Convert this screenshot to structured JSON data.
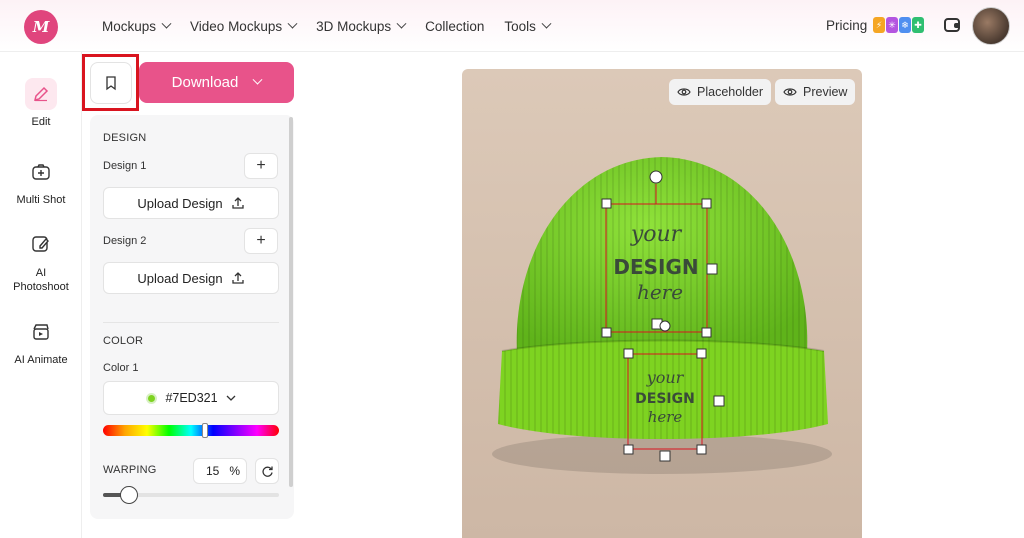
{
  "topnav": {
    "logo_text": "M",
    "items": [
      {
        "label": "Mockups",
        "dropdown": true
      },
      {
        "label": "Video Mockups",
        "dropdown": true
      },
      {
        "label": "3D Mockups",
        "dropdown": true
      },
      {
        "label": "Collection",
        "dropdown": false
      },
      {
        "label": "Tools",
        "dropdown": true
      }
    ],
    "pricing_label": "Pricing",
    "pricing_badge_icons": [
      "lightning-icon",
      "snowflake-icon",
      "snowflake-icon",
      "gamepad-icon"
    ]
  },
  "rail": {
    "items": [
      {
        "label": "Edit",
        "icon": "pencil-icon",
        "active": true
      },
      {
        "label": "Multi Shot",
        "icon": "camera-plus-icon",
        "active": false
      },
      {
        "label": "AI Photoshoot",
        "icon": "edit-image-icon",
        "active": false
      },
      {
        "label": "AI Animate",
        "icon": "clapperboard-icon",
        "active": false
      }
    ]
  },
  "toolbar": {
    "download_label": "Download"
  },
  "panel": {
    "design_section": "DESIGN",
    "design1_label": "Design 1",
    "design2_label": "Design 2",
    "upload_label": "Upload Design",
    "color_section": "COLOR",
    "color1_label": "Color 1",
    "color_value": "#7ED321",
    "hue_position": 0.58,
    "warping_label": "WARPING",
    "warping_value": "15",
    "warping_unit": "%",
    "warping_fraction": 0.15
  },
  "canvas": {
    "placeholder_label": "Placeholder",
    "preview_label": "Preview",
    "hat_color": "#7ED321",
    "design_text": {
      "line1": "your",
      "line2": "DESIGN",
      "line3": "here"
    }
  },
  "colors": {
    "brand": "#E8538A",
    "highlight": "#D9141F",
    "panel_bg": "#F6F6F7"
  }
}
